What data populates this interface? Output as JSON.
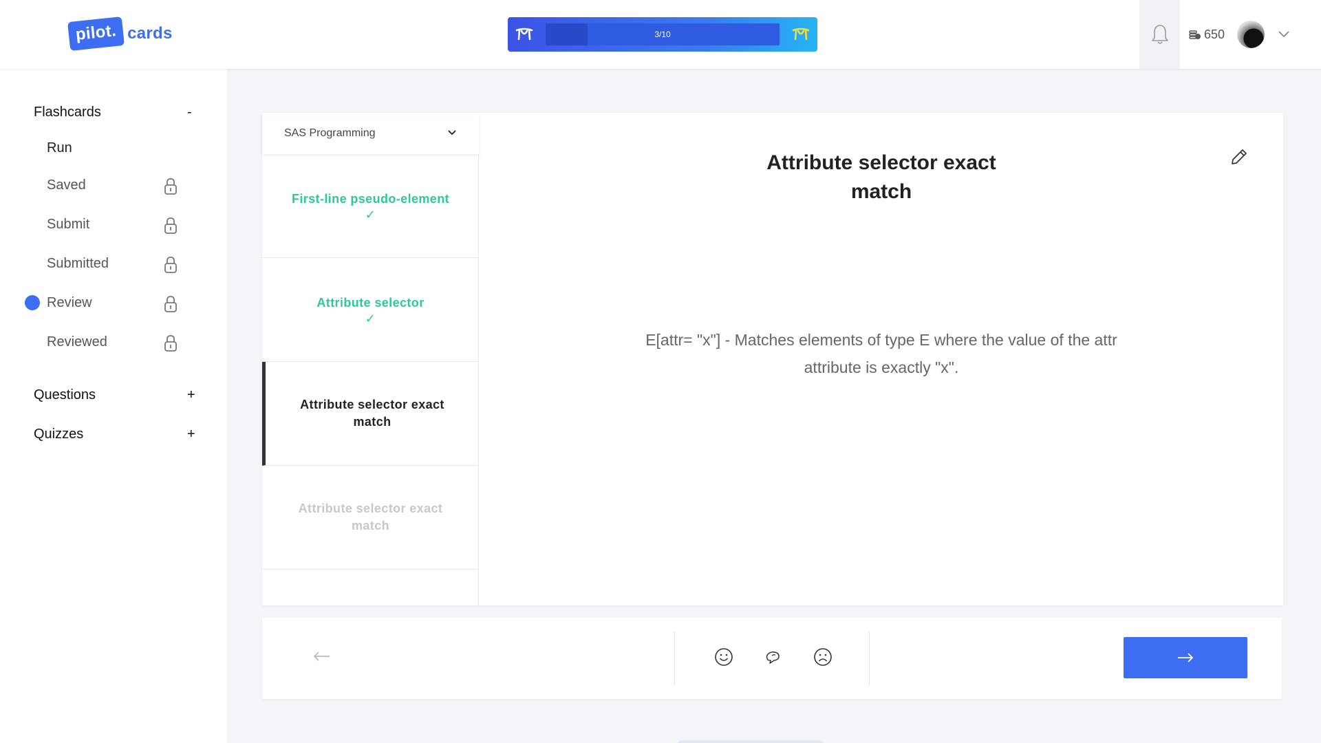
{
  "header": {
    "logo_badge": "pilot.",
    "logo_text": "cards",
    "progress": {
      "label": "3/10",
      "fraction": 0.18
    },
    "coins": "650",
    "icons": [
      "bell-icon",
      "coin-icon",
      "avatar",
      "chevron-down-icon"
    ]
  },
  "sidebar": {
    "flashcards": {
      "title": "Flashcards",
      "toggle": "-"
    },
    "items": [
      {
        "label": "Run",
        "locked": false
      },
      {
        "label": "Saved",
        "locked": true
      },
      {
        "label": "Submit",
        "locked": true
      },
      {
        "label": "Submitted",
        "locked": true
      },
      {
        "label": "Review",
        "locked": true,
        "active": true
      },
      {
        "label": "Reviewed",
        "locked": true
      }
    ],
    "questions": {
      "title": "Questions",
      "toggle": "+"
    },
    "quizzes": {
      "title": "Quizzes",
      "toggle": "+"
    }
  },
  "deck": {
    "selected": "SAS Programming"
  },
  "cards_list": [
    {
      "title": "First-line pseudo-element",
      "status": "done",
      "check": "✓"
    },
    {
      "title": "Attribute selector",
      "status": "done",
      "check": "✓"
    },
    {
      "title": "Attribute selector exact match",
      "status": "active"
    },
    {
      "title": "Attribute selector exact match",
      "status": "future"
    }
  ],
  "card": {
    "title": "Attribute selector exact match",
    "body": "E[attr= \"x\"] - Matches elements of type E where the value of the attr attribute is exactly \"x\"."
  },
  "colors": {
    "accent": "#3d6df2",
    "done": "#2ec999"
  }
}
